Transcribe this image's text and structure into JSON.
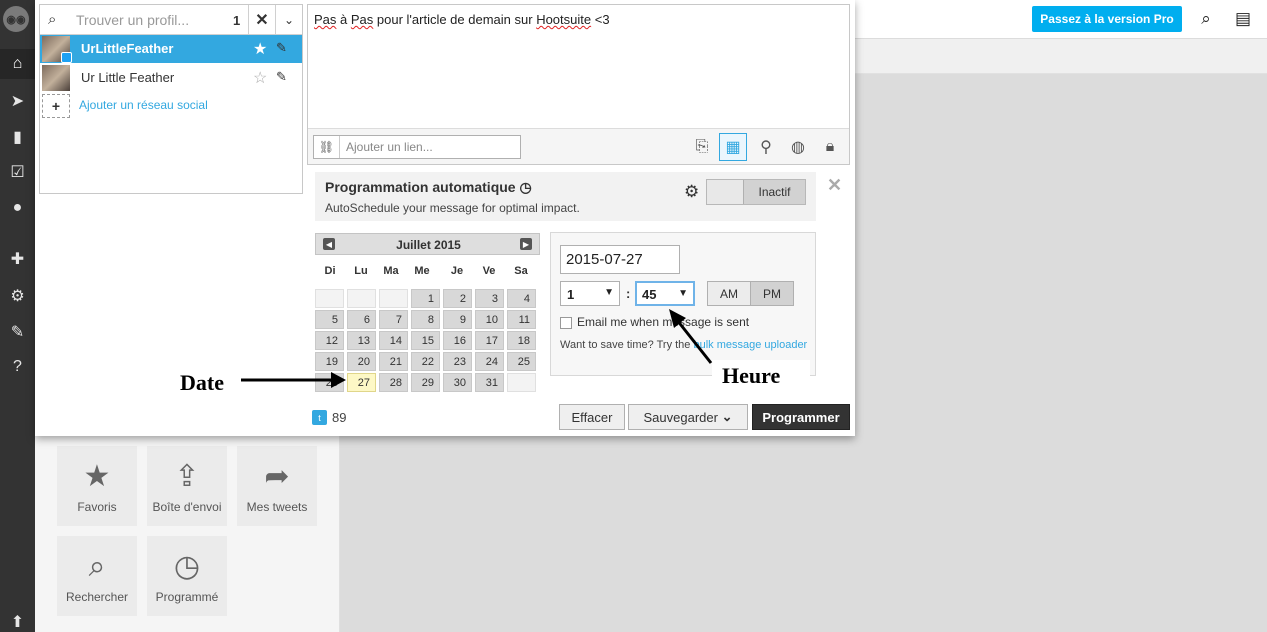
{
  "app": {
    "pro_button": "Passez à la version Pro",
    "logo_icon": "owl-icon",
    "nav_icons": [
      "home-icon",
      "send-icon",
      "analytics-icon",
      "assignments-icon",
      "contacts-icon",
      "apps-icon",
      "settings-icon",
      "tools-icon",
      "help-icon"
    ]
  },
  "tiles": [
    {
      "label": "Favoris",
      "icon": "star-icon"
    },
    {
      "label": "Boîte d'envoi",
      "icon": "outbox-icon"
    },
    {
      "label": "Mes tweets",
      "icon": "share-icon"
    },
    {
      "label": "Rechercher",
      "icon": "search-icon"
    },
    {
      "label": "Programmé",
      "icon": "clock-icon"
    }
  ],
  "profile_picker": {
    "search_placeholder": "Trouver un profil...",
    "selected_count": "1",
    "profiles": [
      {
        "name": "UrLittleFeather",
        "selected": true
      },
      {
        "name": "Ur Little Feather",
        "selected": false
      }
    ],
    "add_network": "Ajouter un réseau social"
  },
  "message": {
    "text_parts": [
      "Pas",
      " à ",
      "Pas",
      " pour l'article de demain sur ",
      "Hootsuite",
      " <3"
    ],
    "link_placeholder": "Ajouter un lien..."
  },
  "autoschedule": {
    "title": "Programmation automatique",
    "description": "AutoSchedule your message for optimal impact.",
    "toggle_label": "Inactif"
  },
  "calendar": {
    "month_title": "Juillet 2015",
    "weekdays": [
      "Di",
      "Lu",
      "Ma",
      "Me",
      "Je",
      "Ve",
      "Sa"
    ],
    "first_weekday_index": 3,
    "days_in_month": 31,
    "selected_day": 27,
    "rows": 6
  },
  "schedule": {
    "date_value": "2015-07-27",
    "hour_value": "1",
    "minute_value": "45",
    "separator": ":",
    "am_label": "AM",
    "pm_label": "PM",
    "active_period": "PM",
    "email_label": "Email me when message is sent",
    "save_time_text": "Want to save time? Try the ",
    "bulk_link": "bulk message uploader"
  },
  "footer": {
    "char_count": "89",
    "clear_button": "Effacer",
    "save_button": "Sauvegarder",
    "schedule_button": "Programmer"
  },
  "annotations": {
    "date_label": "Date",
    "hour_label": "Heure"
  }
}
